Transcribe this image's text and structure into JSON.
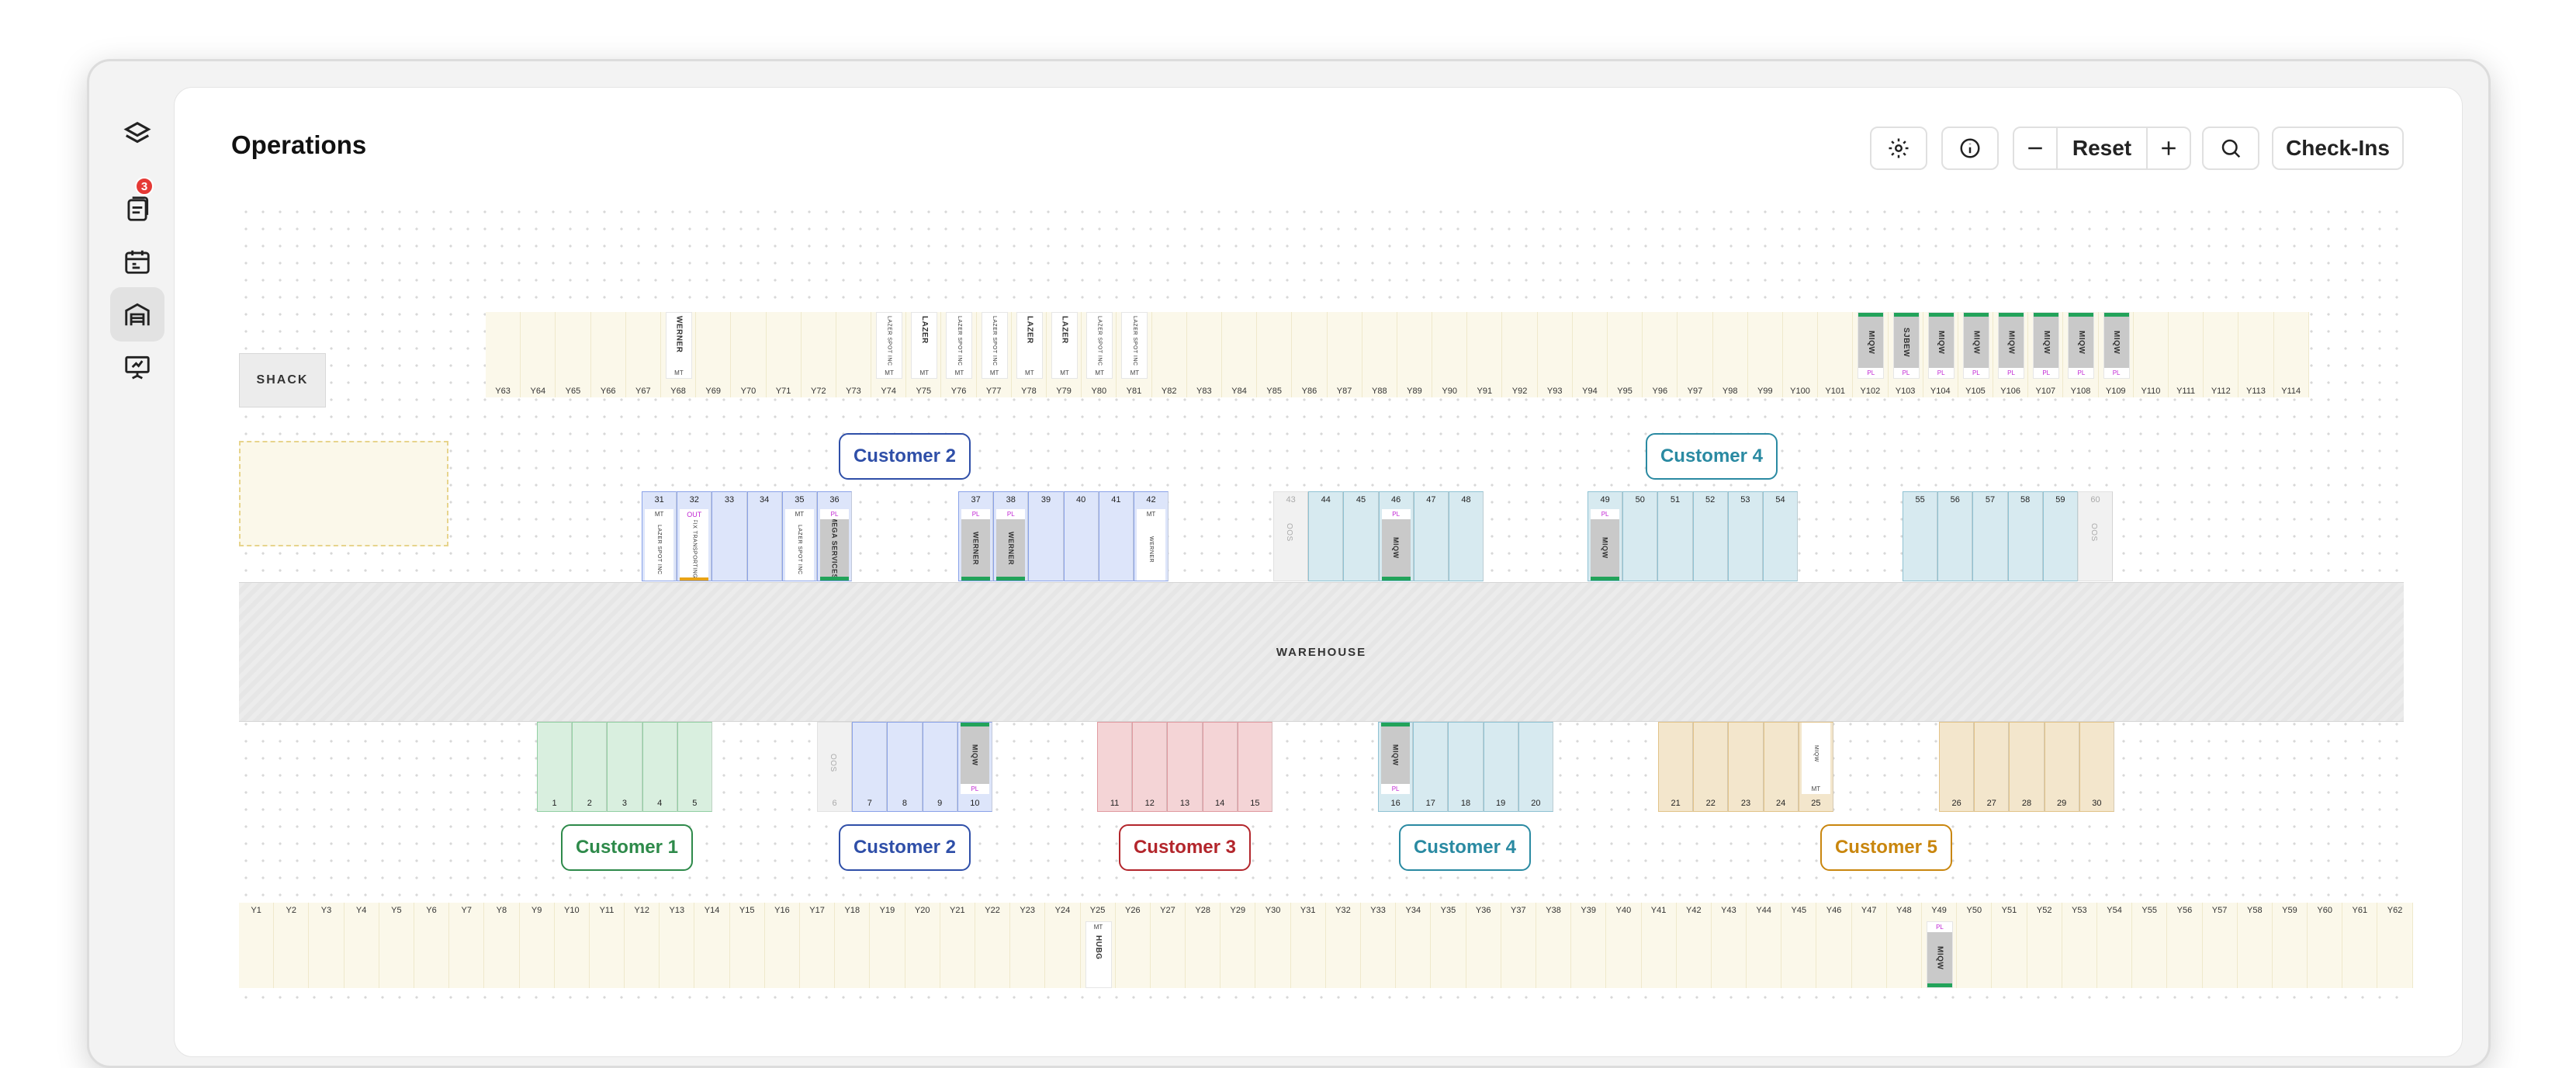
{
  "app": {
    "title": "Operations"
  },
  "sidebar": {
    "items": [
      {
        "icon": "layers-logo-icon"
      },
      {
        "icon": "documents-icon",
        "badge": "3"
      },
      {
        "icon": "calendar-icon"
      },
      {
        "icon": "warehouse-icon",
        "active": true
      },
      {
        "icon": "presentation-icon"
      }
    ]
  },
  "toolbar": {
    "reset_label": "Reset",
    "checkins_label": "Check-Ins"
  },
  "map": {
    "shack_label": "SHACK",
    "warehouse_label": "WAREHOUSE",
    "top_yard": [
      "Y63",
      "Y64",
      "Y65",
      "Y66",
      "Y67",
      "Y68",
      "Y69",
      "Y70",
      "Y71",
      "Y72",
      "Y73",
      "Y74",
      "Y75",
      "Y76",
      "Y77",
      "Y78",
      "Y79",
      "Y80",
      "Y81",
      "Y82",
      "Y83",
      "Y84",
      "Y85",
      "Y86",
      "Y87",
      "Y88",
      "Y89",
      "Y90",
      "Y91",
      "Y92",
      "Y93",
      "Y94",
      "Y95",
      "Y96",
      "Y97",
      "Y98",
      "Y99",
      "Y100",
      "Y101",
      "Y102",
      "Y103",
      "Y104",
      "Y105",
      "Y106",
      "Y107",
      "Y108",
      "Y109",
      "Y110",
      "Y111",
      "Y112",
      "Y113",
      "Y114"
    ],
    "bottom_yard": [
      "Y1",
      "Y2",
      "Y3",
      "Y4",
      "Y5",
      "Y6",
      "Y7",
      "Y8",
      "Y9",
      "Y10",
      "Y11",
      "Y12",
      "Y13",
      "Y14",
      "Y15",
      "Y16",
      "Y17",
      "Y18",
      "Y19",
      "Y20",
      "Y21",
      "Y22",
      "Y23",
      "Y24",
      "Y25",
      "Y26",
      "Y27",
      "Y28",
      "Y29",
      "Y30",
      "Y31",
      "Y32",
      "Y33",
      "Y34",
      "Y35",
      "Y36",
      "Y37",
      "Y38",
      "Y39",
      "Y40",
      "Y41",
      "Y42",
      "Y43",
      "Y44",
      "Y45",
      "Y46",
      "Y47",
      "Y48",
      "Y49",
      "Y50",
      "Y51",
      "Y52",
      "Y53",
      "Y54",
      "Y55",
      "Y56",
      "Y57",
      "Y58",
      "Y59",
      "Y60",
      "Y61",
      "Y62"
    ],
    "top_trailers": [
      {
        "slot": "Y68",
        "text": "WERNER",
        "tag": "MT"
      },
      {
        "slot": "Y74",
        "text": "LAZER SPOT INC",
        "tag": "MT",
        "small": true
      },
      {
        "slot": "Y75",
        "text": "LAZER",
        "tag": "MT"
      },
      {
        "slot": "Y76",
        "text": "LAZER SPOT INC",
        "tag": "MT",
        "small": true
      },
      {
        "slot": "Y77",
        "text": "LAZER SPOT INC",
        "tag": "MT",
        "small": true
      },
      {
        "slot": "Y78",
        "text": "LAZER",
        "tag": "MT"
      },
      {
        "slot": "Y79",
        "text": "LAZER",
        "tag": "MT"
      },
      {
        "slot": "Y80",
        "text": "LAZER SPOT INC",
        "tag": "MT",
        "small": true
      },
      {
        "slot": "Y81",
        "text": "LAZER SPOT INC",
        "tag": "MT",
        "small": true
      },
      {
        "slot": "Y102",
        "text": "MIQW",
        "tag": "PL",
        "loaded": true
      },
      {
        "slot": "Y103",
        "text": "SJBEW",
        "tag": "PL",
        "loaded": true
      },
      {
        "slot": "Y104",
        "text": "MIQW",
        "tag": "PL",
        "loaded": true
      },
      {
        "slot": "Y105",
        "text": "MIQW",
        "tag": "PL",
        "loaded": true
      },
      {
        "slot": "Y106",
        "text": "MIQW",
        "tag": "PL",
        "loaded": true
      },
      {
        "slot": "Y107",
        "text": "MIQW",
        "tag": "PL",
        "loaded": true
      },
      {
        "slot": "Y108",
        "text": "MIQW",
        "tag": "PL",
        "loaded": true
      },
      {
        "slot": "Y109",
        "text": "MIQW",
        "tag": "PL",
        "loaded": true
      }
    ],
    "bottom_trailers": [
      {
        "slot": "Y25",
        "text": "HUBG",
        "tag": "MT"
      },
      {
        "slot": "Y49",
        "text": "MIQW",
        "tag": "PL",
        "loaded": true
      }
    ],
    "customers_top": [
      {
        "label": "Customer 2",
        "color": "#2f4fa8"
      },
      {
        "label": "Customer 4",
        "color": "#2a8aa2"
      }
    ],
    "customers_bottom": [
      {
        "label": "Customer 1",
        "color": "#2e8a4a"
      },
      {
        "label": "Customer 2",
        "color": "#2f4fa8"
      },
      {
        "label": "Customer 3",
        "color": "#b3262c"
      },
      {
        "label": "Customer 4",
        "color": "#2a8aa2"
      },
      {
        "label": "Customer 5",
        "color": "#c9860e"
      }
    ],
    "top_doors": [
      {
        "n": "31",
        "c": "blue",
        "tag": "MT",
        "text": "LAZER SPOT INC"
      },
      {
        "n": "32",
        "c": "blue",
        "out": "OUT",
        "text": "FIX TRANSPORTING"
      },
      {
        "n": "33",
        "c": "blue"
      },
      {
        "n": "34",
        "c": "blue"
      },
      {
        "n": "35",
        "c": "blue",
        "tag": "MT",
        "text": "LAZER SPOT INC"
      },
      {
        "n": "36",
        "c": "blue",
        "tag": "PL",
        "text": "MEGA SERVICES",
        "loaded": true
      },
      {
        "n": "37",
        "c": "blue",
        "tag": "PL",
        "text": "WERNER",
        "loaded": true
      },
      {
        "n": "38",
        "c": "blue",
        "tag": "PL",
        "text": "WERNER",
        "loaded": true
      },
      {
        "n": "39",
        "c": "blue"
      },
      {
        "n": "40",
        "c": "blue"
      },
      {
        "n": "41",
        "c": "blue"
      },
      {
        "n": "42",
        "c": "blue",
        "tag": "MT",
        "text": "WERNER"
      },
      {
        "n": "43",
        "c": "oos",
        "text": "OOS"
      },
      {
        "n": "44",
        "c": "teal"
      },
      {
        "n": "45",
        "c": "teal"
      },
      {
        "n": "46",
        "c": "teal",
        "tag": "PL",
        "text": "MIQW",
        "loaded": true
      },
      {
        "n": "47",
        "c": "teal"
      },
      {
        "n": "48",
        "c": "teal"
      },
      {
        "n": "49",
        "c": "teal",
        "tag": "PL",
        "text": "MIQW",
        "loaded": true
      },
      {
        "n": "50",
        "c": "teal"
      },
      {
        "n": "51",
        "c": "teal"
      },
      {
        "n": "52",
        "c": "teal"
      },
      {
        "n": "53",
        "c": "teal"
      },
      {
        "n": "54",
        "c": "teal"
      },
      {
        "n": "55",
        "c": "teal"
      },
      {
        "n": "56",
        "c": "teal"
      },
      {
        "n": "57",
        "c": "teal"
      },
      {
        "n": "58",
        "c": "teal"
      },
      {
        "n": "59",
        "c": "teal"
      },
      {
        "n": "60",
        "c": "oos",
        "text": "OOS"
      }
    ],
    "bottom_doors": [
      {
        "n": "1",
        "c": "green"
      },
      {
        "n": "2",
        "c": "green"
      },
      {
        "n": "3",
        "c": "green"
      },
      {
        "n": "4",
        "c": "green"
      },
      {
        "n": "5",
        "c": "green"
      },
      {
        "n": "6",
        "c": "oos",
        "text": "OOS"
      },
      {
        "n": "7",
        "c": "blue"
      },
      {
        "n": "8",
        "c": "blue"
      },
      {
        "n": "9",
        "c": "blue"
      },
      {
        "n": "10",
        "c": "blue",
        "tag": "PL",
        "text": "MIQW",
        "loaded": true
      },
      {
        "n": "11",
        "c": "red"
      },
      {
        "n": "12",
        "c": "red"
      },
      {
        "n": "13",
        "c": "red"
      },
      {
        "n": "14",
        "c": "red"
      },
      {
        "n": "15",
        "c": "red"
      },
      {
        "n": "16",
        "c": "teal",
        "tag": "PL",
        "text": "MIQW",
        "loaded": true
      },
      {
        "n": "17",
        "c": "teal"
      },
      {
        "n": "18",
        "c": "teal"
      },
      {
        "n": "19",
        "c": "teal"
      },
      {
        "n": "20",
        "c": "teal"
      },
      {
        "n": "21",
        "c": "amber"
      },
      {
        "n": "22",
        "c": "amber"
      },
      {
        "n": "23",
        "c": "amber"
      },
      {
        "n": "24",
        "c": "amber"
      },
      {
        "n": "25",
        "c": "amber",
        "tag": "MT",
        "text": "MIQW",
        "white": true
      },
      {
        "n": "26",
        "c": "amber"
      },
      {
        "n": "27",
        "c": "amber"
      },
      {
        "n": "28",
        "c": "amber"
      },
      {
        "n": "29",
        "c": "amber"
      },
      {
        "n": "30",
        "c": "amber"
      }
    ],
    "door_colors": {
      "blue": "#dde5fa",
      "teal": "#d7eaf0",
      "green": "#d9efdf",
      "red": "#f4d4d6",
      "amber": "#f3e6cc",
      "oos": "#f1f1f1"
    },
    "door_borders": {
      "blue": "#8aa2e8",
      "teal": "#8fc2d3",
      "green": "#92cfa3",
      "red": "#e09aa0",
      "amber": "#e2c389",
      "oos": "#e2e2e2"
    }
  }
}
